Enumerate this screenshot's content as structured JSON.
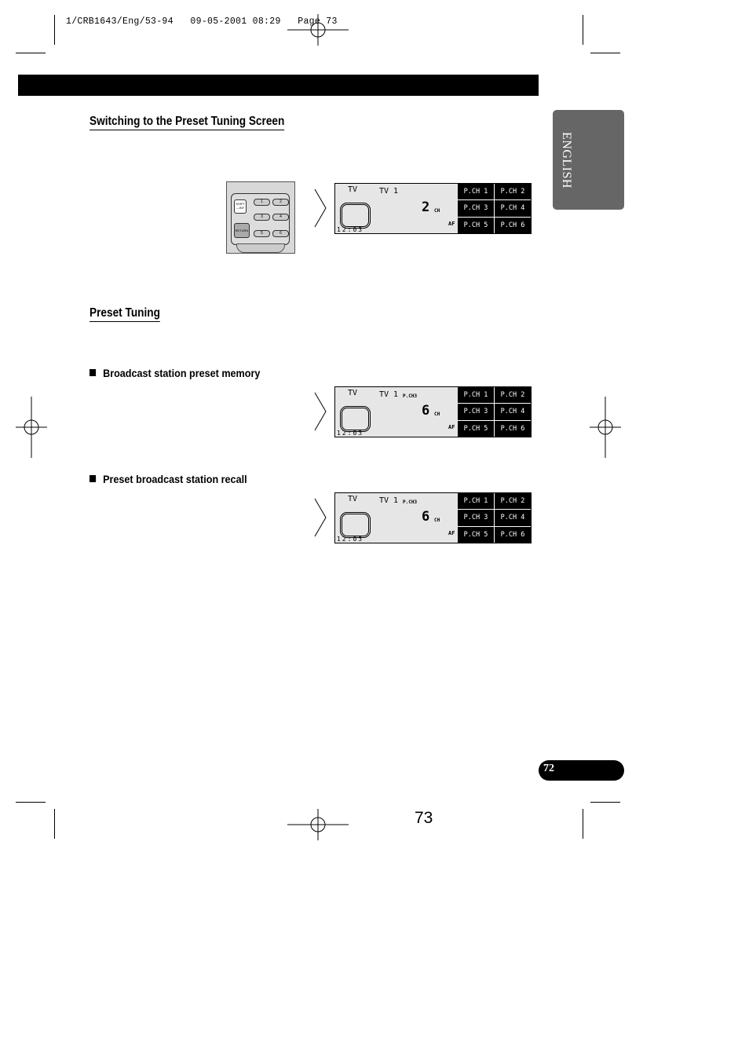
{
  "print_header": "1/CRB1643/Eng/53-94   09-05-2001 08:29   Page 73",
  "language_tab": "ENGLISH",
  "sections": {
    "switching_title": "Switching to the Preset Tuning Screen",
    "preset_title": "Preset Tuning",
    "memory_title": "Broadcast station preset memory",
    "recall_title": "Preset broadcast station recall"
  },
  "remote": {
    "shift_label": "SHIFT\n—INT",
    "return_label": "RETURN",
    "keys": [
      "1",
      "2",
      "3",
      "4",
      "5",
      "6"
    ]
  },
  "displays": [
    {
      "source": "TV",
      "band": "TV 1",
      "preset": "",
      "channel": "2",
      "channel_unit": "CH",
      "af": "AF",
      "clock": "12:03",
      "buttons": [
        "P.CH 1",
        "P.CH 2",
        "P.CH 3",
        "P.CH 4",
        "P.CH 5",
        "P.CH 6"
      ]
    },
    {
      "source": "TV",
      "band": "TV 1",
      "preset": "P.CH3",
      "channel": "6",
      "channel_unit": "CH",
      "af": "AF",
      "clock": "12:03",
      "buttons": [
        "P.CH 1",
        "P.CH 2",
        "P.CH 3",
        "P.CH 4",
        "P.CH 5",
        "P.CH 6"
      ]
    },
    {
      "source": "TV",
      "band": "TV 1",
      "preset": "P.CH3",
      "channel": "6",
      "channel_unit": "CH",
      "af": "AF",
      "clock": "12:03",
      "buttons": [
        "P.CH 1",
        "P.CH 2",
        "P.CH 3",
        "P.CH 4",
        "P.CH 5",
        "P.CH 6"
      ]
    }
  ],
  "footer": {
    "page_pill": "72",
    "page_number": "73"
  }
}
